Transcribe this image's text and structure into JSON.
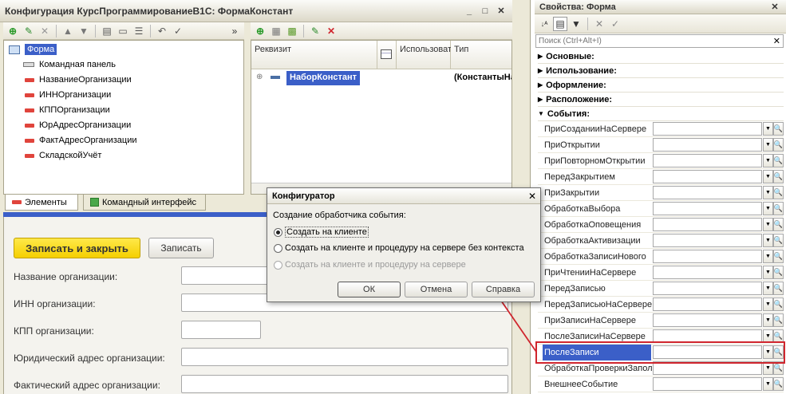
{
  "main_window": {
    "title": "Конфигурация КурсПрограммированиеВ1С: ФормаКонстант",
    "win_controls": {
      "minimize": "_",
      "maximize": "□",
      "close": "✕"
    }
  },
  "elements_panel": {
    "root": "Форма",
    "items": [
      {
        "label": "Командная панель",
        "icon": "command-panel-icon"
      },
      {
        "label": "НазваниеОрганизации",
        "icon": "field-icon"
      },
      {
        "label": "ИННОрганизации",
        "icon": "field-icon"
      },
      {
        "label": "КППОрганизации",
        "icon": "field-icon"
      },
      {
        "label": "ЮрАдресОрганизации",
        "icon": "field-icon"
      },
      {
        "label": "ФактАдресОрганизации",
        "icon": "field-icon"
      },
      {
        "label": "СкладскойУчёт",
        "icon": "field-icon"
      }
    ],
    "tabs": {
      "elements": "Элементы",
      "command_interface": "Командный интерфейс"
    }
  },
  "requisites_panel": {
    "columns": {
      "requisite": "Реквизит",
      "use": "Использовать",
      "type": "Тип"
    },
    "rows": [
      {
        "name": "НаборКонстант",
        "type": "(КонстантыНаб"
      }
    ]
  },
  "preview_form": {
    "buttons": {
      "save_close": "Записать и закрыть",
      "save": "Записать"
    },
    "fields": [
      {
        "label": "Название организации:"
      },
      {
        "label": "ИНН организации:"
      },
      {
        "label": "КПП организации:"
      },
      {
        "label": "Юридический адрес организации:"
      },
      {
        "label": "Фактический адрес организации:"
      }
    ]
  },
  "dialog": {
    "title": "Конфигуратор",
    "prompt": "Создание обработчика события:",
    "options": [
      {
        "label": "Создать на клиенте",
        "checked": true,
        "disabled": false
      },
      {
        "label": "Создать на клиенте и процедуру на сервере без контекста",
        "checked": false,
        "disabled": false
      },
      {
        "label": "Создать на клиенте и процедуру на сервере",
        "checked": false,
        "disabled": true
      }
    ],
    "buttons": {
      "ok": "ОК",
      "cancel": "Отмена",
      "help": "Справка"
    },
    "close": "✕"
  },
  "properties_panel": {
    "title": "Свойства: Форма",
    "search_placeholder": "Поиск (Ctrl+Alt+I)",
    "sections": [
      {
        "label": "Основные:",
        "expanded": false
      },
      {
        "label": "Использование:",
        "expanded": false
      },
      {
        "label": "Оформление:",
        "expanded": false
      },
      {
        "label": "Расположение:",
        "expanded": false
      },
      {
        "label": "События:",
        "expanded": true
      }
    ],
    "events": [
      "ПриСозданииНаСервере",
      "ПриОткрытии",
      "ПриПовторномОткрытии",
      "ПередЗакрытием",
      "ПриЗакрытии",
      "ОбработкаВыбора",
      "ОбработкаОповещения",
      "ОбработкаАктивизации",
      "ОбработкаЗаписиНового",
      "ПриЧтенииНаСервере",
      "ПередЗаписью",
      "ПередЗаписьюНаСервере",
      "ПриЗаписиНаСервере",
      "ПослеЗаписиНаСервере",
      "ПослеЗаписи",
      "ОбработкаПроверкиЗапол",
      "ВнешнееСобытие"
    ],
    "selected_event": "ПослеЗаписи",
    "colors": {
      "selection": "#3b5fc8",
      "highlight_border": "#d0262e",
      "arrow": "#d0262e"
    }
  }
}
